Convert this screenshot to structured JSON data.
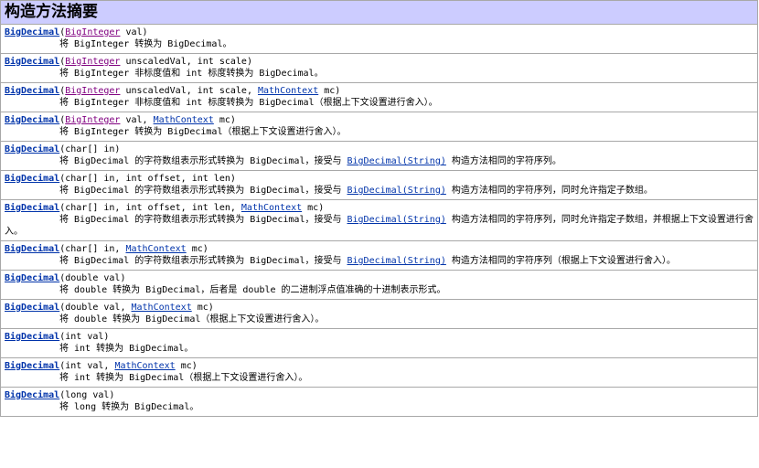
{
  "header": {
    "title": "构造方法摘要"
  },
  "rows": [
    {
      "name": "BigDecimal",
      "sig": [
        {
          "t": "(",
          "link": false
        },
        {
          "t": "BigInteger",
          "link": true,
          "visited": true
        },
        {
          "t": " val)",
          "link": false
        }
      ],
      "desc": [
        {
          "t": "将 BigInteger 转换为 BigDecimal。",
          "link": false
        }
      ]
    },
    {
      "name": "BigDecimal",
      "sig": [
        {
          "t": "(",
          "link": false
        },
        {
          "t": "BigInteger",
          "link": true,
          "visited": true
        },
        {
          "t": " unscaledVal, int scale)",
          "link": false
        }
      ],
      "desc": [
        {
          "t": "将 BigInteger 非标度值和 int 标度转换为 BigDecimal。",
          "link": false
        }
      ]
    },
    {
      "name": "BigDecimal",
      "sig": [
        {
          "t": "(",
          "link": false
        },
        {
          "t": "BigInteger",
          "link": true,
          "visited": true
        },
        {
          "t": " unscaledVal, int scale, ",
          "link": false
        },
        {
          "t": "MathContext",
          "link": true
        },
        {
          "t": " mc)",
          "link": false
        }
      ],
      "desc": [
        {
          "t": "将 BigInteger 非标度值和 int 标度转换为 BigDecimal（根据上下文设置进行舍入）。",
          "link": false
        }
      ]
    },
    {
      "name": "BigDecimal",
      "sig": [
        {
          "t": "(",
          "link": false
        },
        {
          "t": "BigInteger",
          "link": true,
          "visited": true
        },
        {
          "t": " val, ",
          "link": false
        },
        {
          "t": "MathContext",
          "link": true
        },
        {
          "t": " mc)",
          "link": false
        }
      ],
      "desc": [
        {
          "t": "将 BigInteger 转换为 BigDecimal（根据上下文设置进行舍入）。",
          "link": false
        }
      ]
    },
    {
      "name": "BigDecimal",
      "sig": [
        {
          "t": "(char[] in)",
          "link": false
        }
      ],
      "desc": [
        {
          "t": "将 BigDecimal 的字符数组表示形式转换为 BigDecimal，接受与 ",
          "link": false
        },
        {
          "t": "BigDecimal(String)",
          "link": true
        },
        {
          "t": " 构造方法相同的字符序列。",
          "link": false
        }
      ]
    },
    {
      "name": "BigDecimal",
      "sig": [
        {
          "t": "(char[] in, int offset, int len)",
          "link": false
        }
      ],
      "desc": [
        {
          "t": "将 BigDecimal 的字符数组表示形式转换为 BigDecimal，接受与 ",
          "link": false
        },
        {
          "t": "BigDecimal(String)",
          "link": true
        },
        {
          "t": " 构造方法相同的字符序列，同时允许指定子数组。",
          "link": false
        }
      ]
    },
    {
      "name": "BigDecimal",
      "sig": [
        {
          "t": "(char[] in, int offset, int len, ",
          "link": false
        },
        {
          "t": "MathContext",
          "link": true
        },
        {
          "t": " mc)",
          "link": false
        }
      ],
      "desc": [
        {
          "t": "将 BigDecimal 的字符数组表示形式转换为 BigDecimal，接受与 ",
          "link": false
        },
        {
          "t": "BigDecimal(String)",
          "link": true
        },
        {
          "t": " 构造方法相同的字符序列，同时允许指定子数组，并根据上下文设置进行舍入。",
          "link": false
        }
      ]
    },
    {
      "name": "BigDecimal",
      "sig": [
        {
          "t": "(char[] in, ",
          "link": false
        },
        {
          "t": "MathContext",
          "link": true
        },
        {
          "t": " mc)",
          "link": false
        }
      ],
      "desc": [
        {
          "t": "将 BigDecimal 的字符数组表示形式转换为 BigDecimal，接受与 ",
          "link": false
        },
        {
          "t": "BigDecimal(String)",
          "link": true
        },
        {
          "t": " 构造方法相同的字符序列（根据上下文设置进行舍入）。",
          "link": false
        }
      ]
    },
    {
      "name": "BigDecimal",
      "sig": [
        {
          "t": "(double val)",
          "link": false
        }
      ],
      "desc": [
        {
          "t": "将 double 转换为 BigDecimal，后者是 double 的二进制浮点值准确的十进制表示形式。",
          "link": false
        }
      ]
    },
    {
      "name": "BigDecimal",
      "sig": [
        {
          "t": "(double val, ",
          "link": false
        },
        {
          "t": "MathContext",
          "link": true
        },
        {
          "t": " mc)",
          "link": false
        }
      ],
      "desc": [
        {
          "t": "将 double 转换为 BigDecimal（根据上下文设置进行舍入）。",
          "link": false
        }
      ]
    },
    {
      "name": "BigDecimal",
      "sig": [
        {
          "t": "(int val)",
          "link": false
        }
      ],
      "desc": [
        {
          "t": "将 int 转换为 BigDecimal。",
          "link": false
        }
      ]
    },
    {
      "name": "BigDecimal",
      "sig": [
        {
          "t": "(int val, ",
          "link": false
        },
        {
          "t": "MathContext",
          "link": true
        },
        {
          "t": " mc)",
          "link": false
        }
      ],
      "desc": [
        {
          "t": "将 int 转换为 BigDecimal（根据上下文设置进行舍入）。",
          "link": false
        }
      ]
    },
    {
      "name": "BigDecimal",
      "sig": [
        {
          "t": "(long val)",
          "link": false
        }
      ],
      "desc": [
        {
          "t": "将 long 转换为 BigDecimal。",
          "link": false
        }
      ]
    }
  ]
}
